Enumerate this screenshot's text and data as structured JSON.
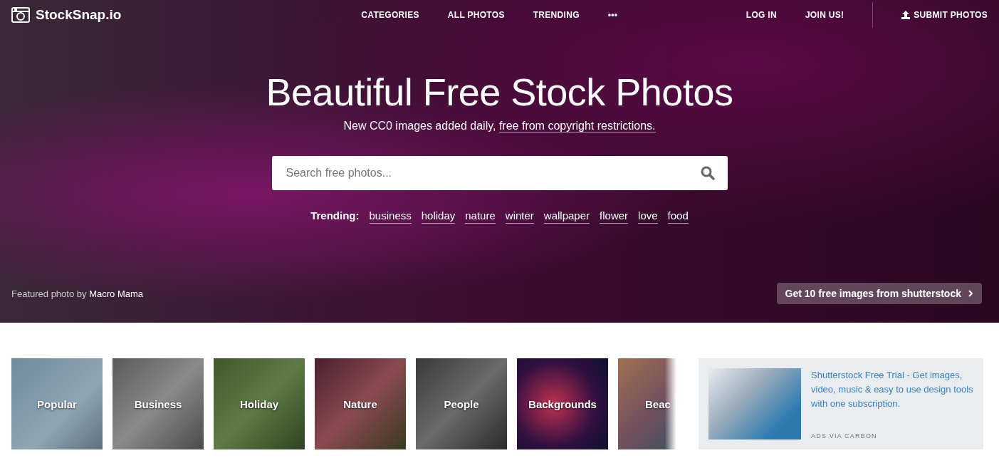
{
  "logo": {
    "text": "StockSnap.io"
  },
  "nav": {
    "center": [
      "CATEGORIES",
      "ALL PHOTOS",
      "TRENDING",
      "•••"
    ],
    "right": [
      "LOG IN",
      "JOIN US!"
    ],
    "submit": "SUBMIT PHOTOS"
  },
  "hero": {
    "title": "Beautiful Free Stock Photos",
    "subtitle": "New CC0 images added daily,",
    "subtitle_link": "free from copyright restrictions.",
    "search": {
      "placeholder": "Search free photos..."
    },
    "trending_label": "Trending:",
    "trending": [
      "business",
      "holiday",
      "nature",
      "winter",
      "wallpaper",
      "flower",
      "love",
      "food"
    ],
    "credit_prefix": "Featured photo by",
    "credit_name": "Macro Mama",
    "promo": "Get 10 free images from shutterstock"
  },
  "categories": [
    {
      "label": "Popular",
      "faded": false
    },
    {
      "label": "Business",
      "faded": false
    },
    {
      "label": "Holiday",
      "faded": false
    },
    {
      "label": "Nature",
      "faded": false
    },
    {
      "label": "People",
      "faded": false
    },
    {
      "label": "Backgrounds",
      "faded": false
    },
    {
      "label": "Beac",
      "faded": true
    }
  ],
  "ad": {
    "text": "Shutterstock Free Trial - Get images, video, music & easy to use design tools with one subscription.",
    "footer": "ADS VIA CARBON"
  }
}
